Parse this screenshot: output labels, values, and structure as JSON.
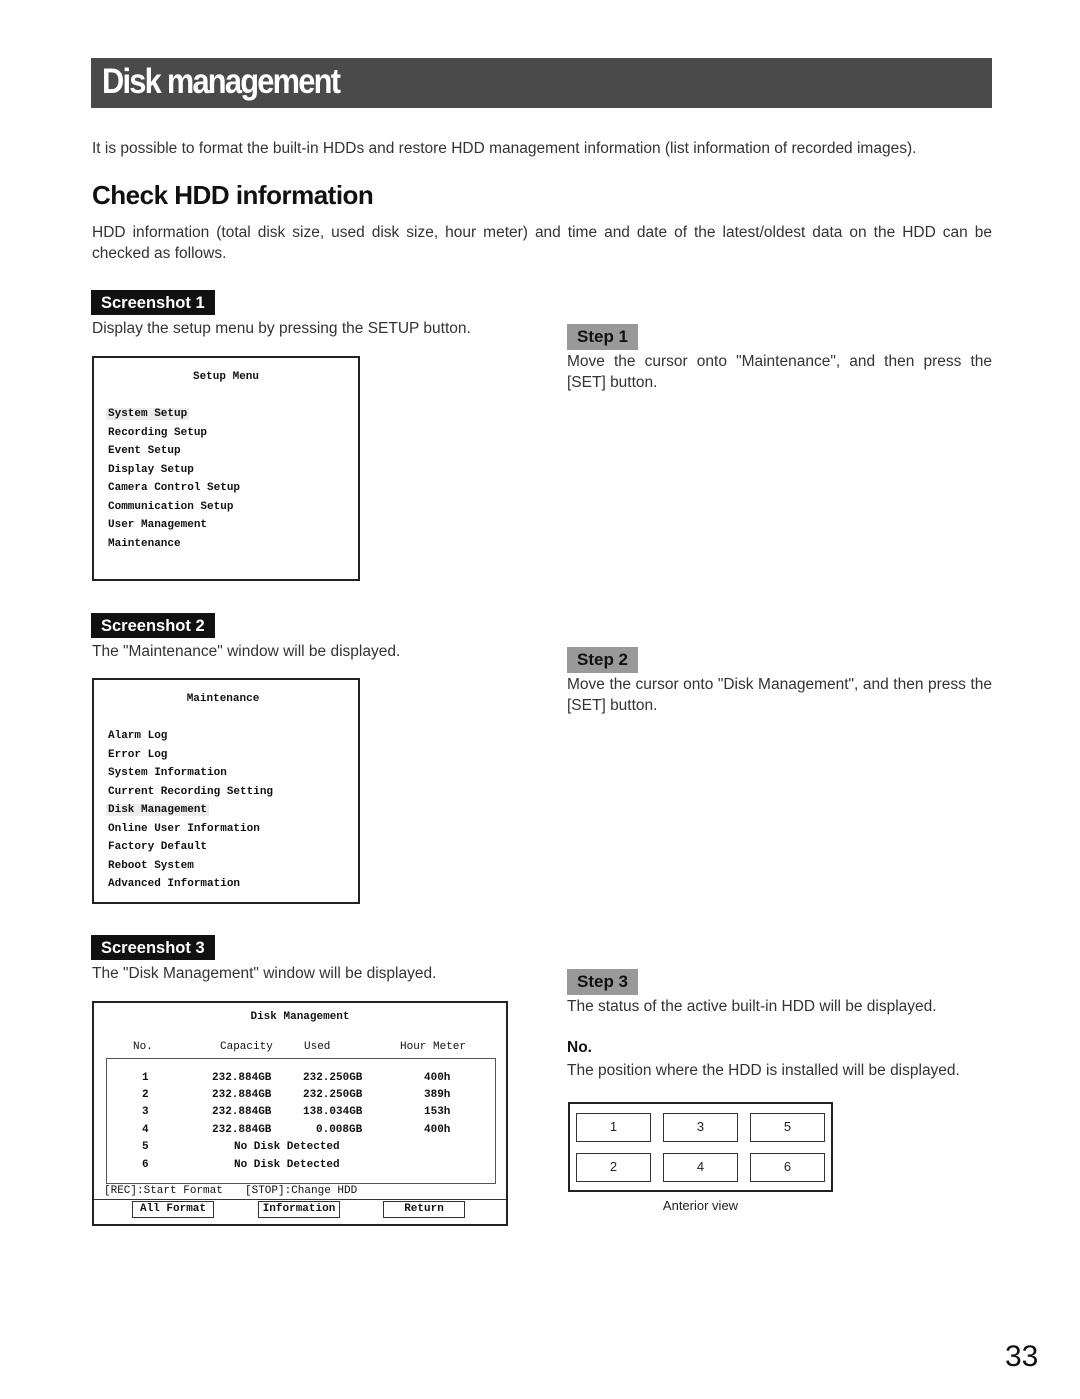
{
  "page": {
    "title": "Disk management",
    "intro": "It is possible to format the built-in HDDs and restore HDD management information (list information of recorded images).",
    "section_title": "Check HDD information",
    "section_text": "HDD information (total disk size, used disk size, hour meter) and time and date of the latest/oldest data on the HDD can be checked as follows.",
    "page_number": "33"
  },
  "screenshots": [
    {
      "badge": "Screenshot 1",
      "desc": "Display the setup menu by pressing the SETUP button.",
      "osd_title": "Setup Menu",
      "items": [
        "System Setup",
        "Recording Setup",
        "Event Setup",
        "Display Setup",
        "Camera Control Setup",
        "Communication Setup",
        "User Management",
        "Maintenance"
      ],
      "selected": "System Setup"
    },
    {
      "badge": "Screenshot 2",
      "desc": "The \"Maintenance\" window will be displayed.",
      "osd_title": "Maintenance",
      "items": [
        "Alarm Log",
        "Error Log",
        "System Information",
        "Current Recording Setting",
        "Disk Management",
        "Online User Information",
        "Factory Default",
        "Reboot System",
        "Advanced Information"
      ],
      "selected": "Disk Management"
    },
    {
      "badge": "Screenshot 3",
      "desc": "The \"Disk Management\" window will be displayed.",
      "osd_title": "Disk Management",
      "columns": [
        "No.",
        "Capacity",
        "Used",
        "Hour Meter"
      ],
      "rows": [
        {
          "no": "1",
          "capacity": "232.884GB",
          "used": "232.250GB",
          "hours": "400h"
        },
        {
          "no": "2",
          "capacity": "232.884GB",
          "used": "232.250GB",
          "hours": "389h"
        },
        {
          "no": "3",
          "capacity": "232.884GB",
          "used": "138.034GB",
          "hours": "153h"
        },
        {
          "no": "4",
          "capacity": "232.884GB",
          "used": "0.008GB",
          "hours": "400h"
        },
        {
          "no": "5",
          "status": "No Disk Detected"
        },
        {
          "no": "6",
          "status": "No Disk Detected"
        }
      ],
      "hint_rec": "[REC]:Start Format",
      "hint_stop": "[STOP]:Change HDD",
      "buttons": [
        "All Format",
        "Information",
        "Return"
      ]
    }
  ],
  "steps": [
    {
      "badge": "Step 1",
      "text": "Move the cursor onto \"Maintenance\", and then press the [SET] button."
    },
    {
      "badge": "Step 2",
      "text": "Move the cursor onto \"Disk Management\", and then press the [SET] button."
    },
    {
      "badge": "Step 3",
      "text": "The status of the active built-in HDD will be displayed."
    }
  ],
  "no_section": {
    "heading": "No.",
    "text": "The position where the HDD is installed will be displayed.",
    "bays": [
      "1",
      "3",
      "5",
      "2",
      "4",
      "6"
    ],
    "caption": "Anterior view"
  }
}
